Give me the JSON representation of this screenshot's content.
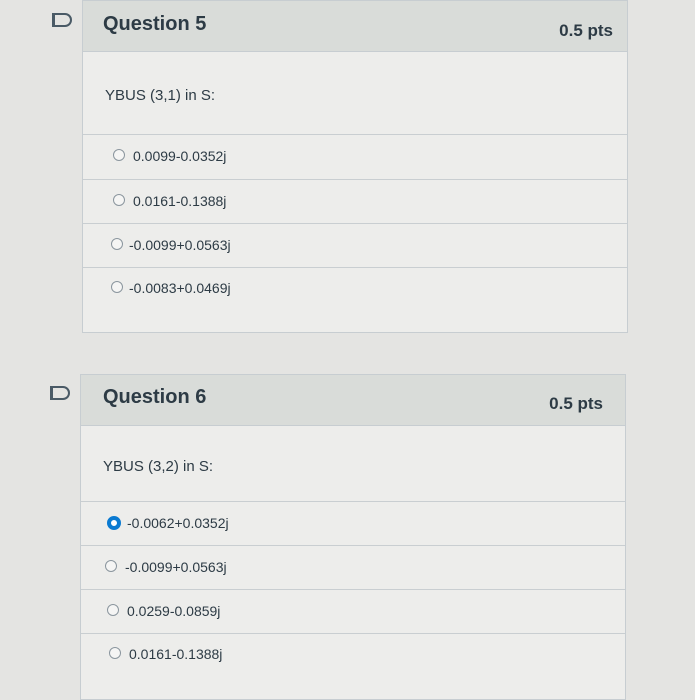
{
  "questions": [
    {
      "title": "Question 5",
      "points": "0.5 pts",
      "prompt": "YBUS (3,1) in S:",
      "answers": [
        {
          "label": "0.0099-0.0352j",
          "selected": false
        },
        {
          "label": "0.0161-0.1388j",
          "selected": false
        },
        {
          "label": "-0.0099+0.0563j",
          "selected": false
        },
        {
          "label": "-0.0083+0.0469j",
          "selected": false
        }
      ]
    },
    {
      "title": "Question 6",
      "points": "0.5 pts",
      "prompt": "YBUS (3,2) in S:",
      "answers": [
        {
          "label": "-0.0062+0.0352j",
          "selected": true
        },
        {
          "label": "-0.0099+0.0563j",
          "selected": false
        },
        {
          "label": "0.0259-0.0859j",
          "selected": false
        },
        {
          "label": "0.0161-0.1388j",
          "selected": false
        }
      ]
    }
  ],
  "colors": {
    "accent": "#0a7ad1",
    "header_bg": "#d9dcd9",
    "card_bg": "#ededeb"
  }
}
